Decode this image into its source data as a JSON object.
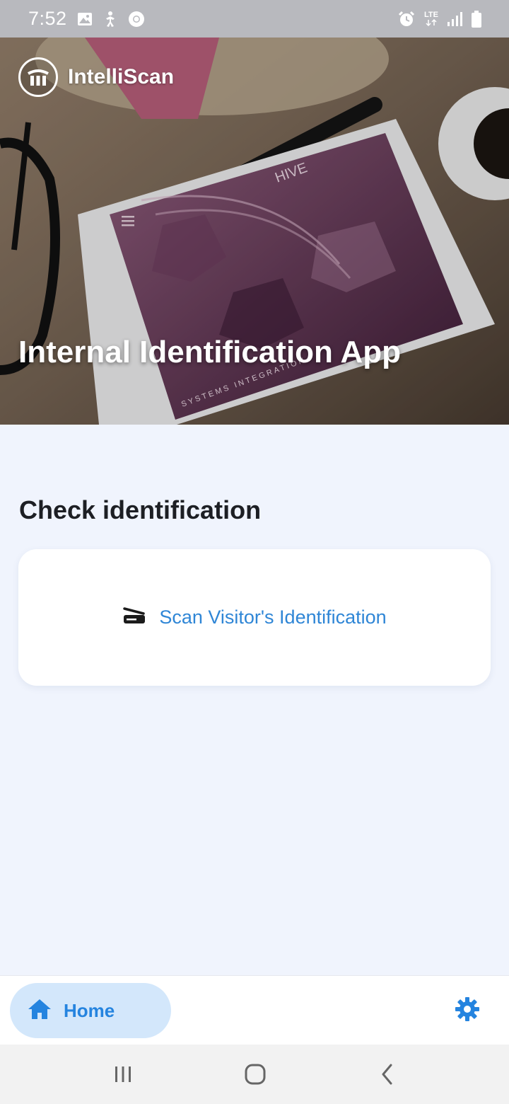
{
  "status_bar": {
    "time": "7:52",
    "network_label": "LTE",
    "left_icons": [
      "image-icon",
      "accessibility-icon",
      "chrome-icon"
    ],
    "right_icons": [
      "alarm-icon",
      "lte-icon",
      "signal-icon",
      "battery-icon"
    ]
  },
  "hero": {
    "brand_name": "IntelliScan",
    "title": "Internal Identification App",
    "background_image_text": [
      "HIVE",
      "SYSTEMS INTEGRATION"
    ]
  },
  "main": {
    "section_title": "Check identification",
    "scan_card": {
      "label": "Scan Visitor's Identification",
      "icon": "scanner-icon"
    }
  },
  "bottom_nav": {
    "home_label": "Home",
    "home_icon": "home-icon",
    "settings_icon": "gear-icon"
  },
  "system_nav": {
    "buttons": [
      "recent-apps-icon",
      "home-circle-icon",
      "back-icon"
    ]
  },
  "colors": {
    "accent": "#2f86d6",
    "home_tab_bg": "#d3e7fb",
    "page_bg": "#f0f4fd",
    "status_bar_bg": "#b8b9be"
  }
}
